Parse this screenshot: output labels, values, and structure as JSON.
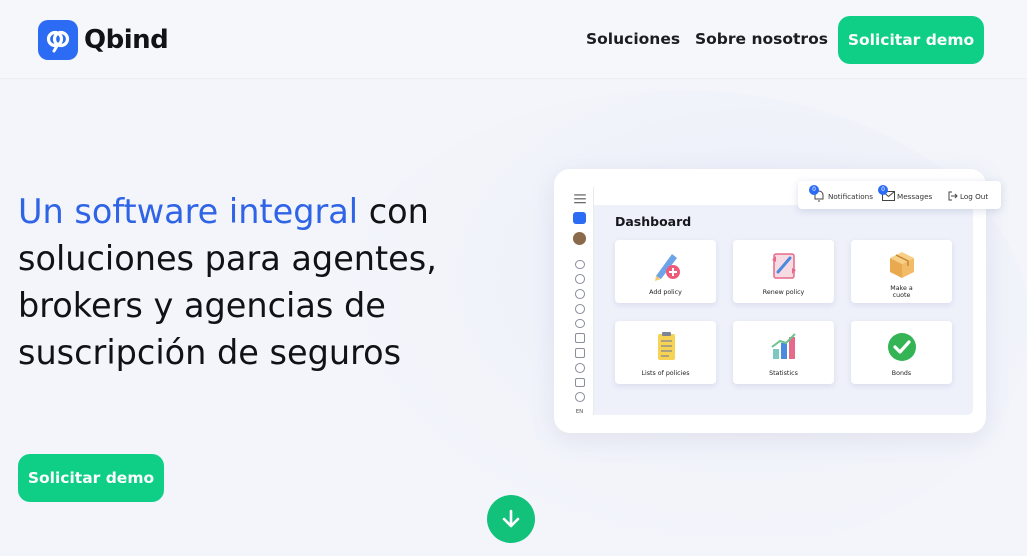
{
  "brand": {
    "name": "Qbind"
  },
  "nav": {
    "items": [
      "Soluciones",
      "Sobre nosotros"
    ],
    "cta": "Solicitar demo"
  },
  "hero": {
    "title_accent": "Un software integral",
    "title_rest_1": " con",
    "title_line_2": "soluciones para agentes,",
    "title_line_3": "brokers y agencias de",
    "title_line_4": "suscripción de seguros",
    "cta": "Solicitar demo"
  },
  "mock": {
    "notifications": {
      "count": "0",
      "label": "Notifications"
    },
    "messages": {
      "count": "0",
      "label": "Messages"
    },
    "logout": "Log Out",
    "language": "EN",
    "title": "Dashboard",
    "cards": [
      {
        "label": "Add policy",
        "icon": "add-policy-icon"
      },
      {
        "label": "Renew policy",
        "icon": "renew-policy-icon"
      },
      {
        "label": "Make a\ncuote",
        "icon": "box-icon"
      },
      {
        "label": "Lists of policies",
        "icon": "clipboard-icon"
      },
      {
        "label": "Statistics",
        "icon": "statistics-icon"
      },
      {
        "label": "Bonds",
        "icon": "checkmark-icon"
      }
    ]
  },
  "colors": {
    "accent_blue": "#2f64e6",
    "brand_green": "#0fcf86",
    "logo_blue": "#2c6bf3"
  }
}
